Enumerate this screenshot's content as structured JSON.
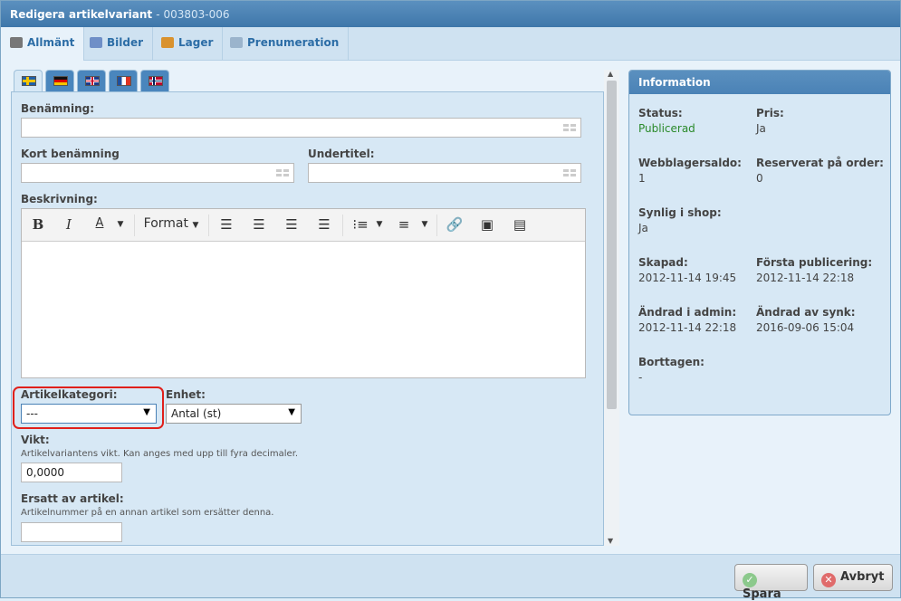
{
  "window": {
    "title": "Redigera artikelvariant",
    "subtitle": "- 003803-006"
  },
  "tabs": [
    {
      "label": "Allmänt",
      "icon": "keyboard-icon"
    },
    {
      "label": "Bilder",
      "icon": "images-icon"
    },
    {
      "label": "Lager",
      "icon": "box-icon"
    },
    {
      "label": "Prenumeration",
      "icon": "subscription-icon"
    }
  ],
  "languages": [
    "sv",
    "de",
    "gb",
    "fr",
    "no"
  ],
  "form": {
    "benamning_label": "Benämning:",
    "benamning_value": "",
    "kort_label": "Kort benämning",
    "kort_value": "",
    "undertitel_label": "Undertitel:",
    "undertitel_value": "",
    "beskrivning_label": "Beskrivning:",
    "editor_format_label": "Format",
    "artikelkategori_label": "Artikelkategori:",
    "artikelkategori_value": "---",
    "enhet_label": "Enhet:",
    "enhet_value": "Antal (st)",
    "vikt_label": "Vikt:",
    "vikt_hint": "Artikelvariantens vikt. Kan anges med upp till fyra decimaler.",
    "vikt_value": "0,0000",
    "ersatt_label": "Ersatt av artikel:",
    "ersatt_hint": "Artikelnummer på en annan artikel som ersätter denna.",
    "ersatt_value": ""
  },
  "info": {
    "title": "Information",
    "status_label": "Status:",
    "status_value": "Publicerad",
    "pris_label": "Pris:",
    "pris_value": "Ja",
    "webblager_label": "Webblagersaldo:",
    "webblager_value": "1",
    "reserverat_label": "Reserverat på order:",
    "reserverat_value": "0",
    "synlig_label": "Synlig i shop:",
    "synlig_value": "Ja",
    "skapad_label": "Skapad:",
    "skapad_value": "2012-11-14 19:45",
    "forsta_label": "Första publicering:",
    "forsta_value": "2012-11-14 22:18",
    "andrad_admin_label": "Ändrad i admin:",
    "andrad_admin_value": "2012-11-14 22:18",
    "andrad_synk_label": "Ändrad av synk:",
    "andrad_synk_value": "2016-09-06 15:04",
    "borttagen_label": "Borttagen:",
    "borttagen_value": "-"
  },
  "footer": {
    "save_label": "Spara",
    "cancel_label": "Avbryt"
  },
  "colors": {
    "accent": "#4a82b6",
    "status_green": "#2b8a2b",
    "highlight_red": "#e0201b"
  }
}
